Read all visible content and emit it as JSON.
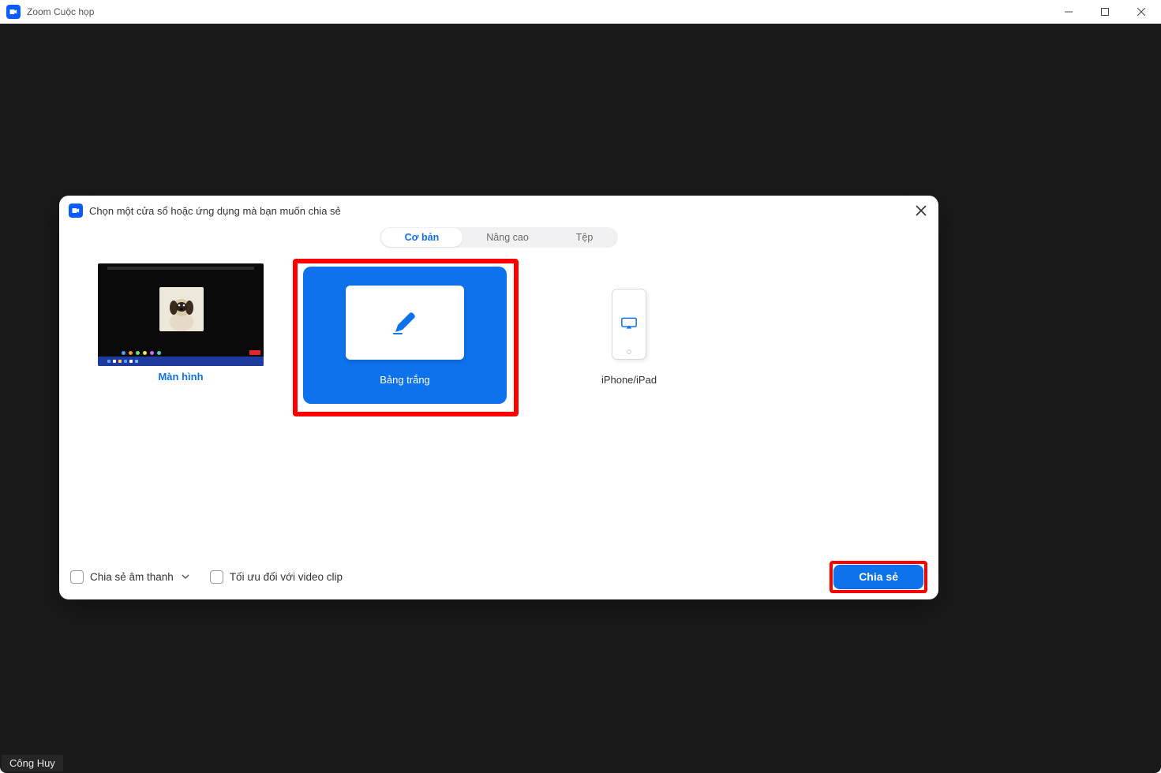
{
  "window": {
    "title": "Zoom Cuộc họp"
  },
  "dialog": {
    "title": "Chọn một cửa sổ hoặc ứng dụng mà bạn muốn chia sẻ",
    "tabs": {
      "basic": "Cơ bản",
      "advanced": "Nâng cao",
      "files": "Tệp"
    },
    "options": {
      "screen": "Màn hình",
      "whiteboard": "Bảng trắng",
      "iphone": "iPhone/iPad"
    },
    "footer": {
      "share_audio": "Chia sẻ âm thanh",
      "optimize_video": "Tối ưu đối với video clip",
      "share_button": "Chia sẻ"
    }
  },
  "watermark": "Công Huy"
}
